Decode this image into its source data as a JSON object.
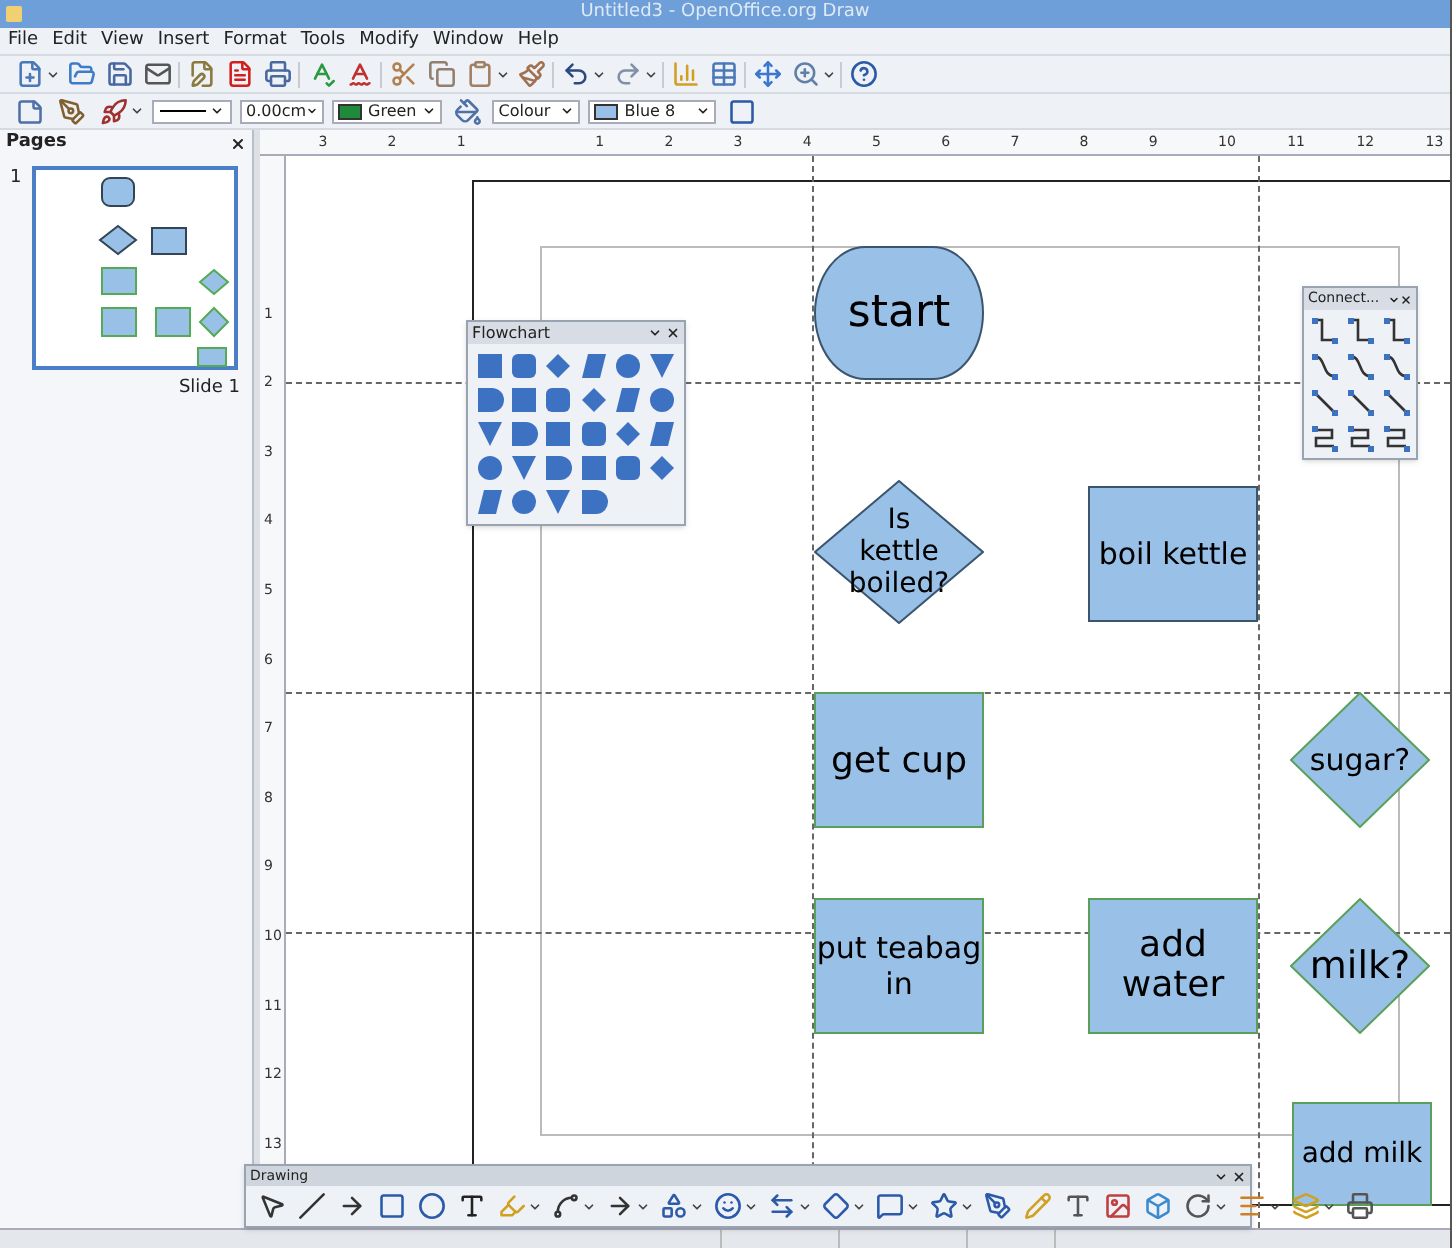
{
  "window": {
    "title": "Untitled3 - OpenOffice.org Draw"
  },
  "menu": [
    "File",
    "Edit",
    "View",
    "Insert",
    "Format",
    "Tools",
    "Modify",
    "Window",
    "Help"
  ],
  "line_width": "0.00cm",
  "line_color": {
    "label": "Green",
    "color": "#1e8a3c"
  },
  "area_style": "Colour",
  "area_color": {
    "label": "Blue 8",
    "color": "#99c0e6"
  },
  "pages_panel": {
    "title": "Pages",
    "pages": [
      {
        "number": "1",
        "label": "Slide 1",
        "selected": true
      }
    ]
  },
  "ruler_h": [
    "3",
    "2",
    "1",
    "1",
    "2",
    "3",
    "4",
    "5",
    "6",
    "7",
    "8",
    "9",
    "10",
    "11",
    "12",
    "13"
  ],
  "ruler_v": [
    "1",
    "2",
    "3",
    "4",
    "5",
    "6",
    "7",
    "8",
    "9",
    "10",
    "11",
    "12",
    "13"
  ],
  "flowchart_toolbar": {
    "title": "Flowchart"
  },
  "connectors_toolbar": {
    "title": "Connect..."
  },
  "drawing_toolbar": {
    "title": "Drawing"
  },
  "shapes": [
    {
      "kind": "terminator",
      "label": "start",
      "color": "#3b556e"
    },
    {
      "kind": "decision",
      "label": "Is kettle boiled?",
      "color": "#3b556e"
    },
    {
      "kind": "process",
      "label": "boil kettle",
      "color": "#3b556e"
    },
    {
      "kind": "process",
      "label": "get cup",
      "color": "#5aa05a"
    },
    {
      "kind": "decision",
      "label": "sugar?",
      "color": "#5aa05a"
    },
    {
      "kind": "process",
      "label": "put teabag in",
      "color": "#5aa05a"
    },
    {
      "kind": "process",
      "label": "add water",
      "color": "#5aa05a"
    },
    {
      "kind": "decision",
      "label": "milk?",
      "color": "#5aa05a"
    },
    {
      "kind": "process",
      "label": "add milk",
      "color": "#5aa05a"
    }
  ]
}
